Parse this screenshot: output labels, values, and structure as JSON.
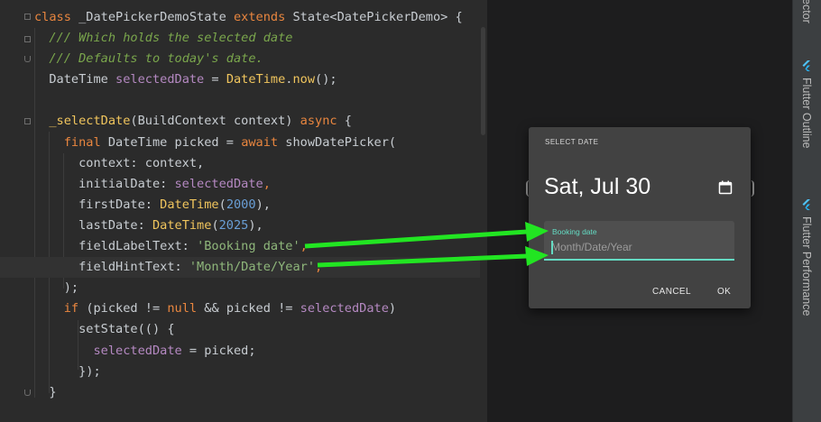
{
  "editor": {
    "lines": [
      [
        [
          "kw",
          "class "
        ],
        [
          "cls",
          "_DatePickerDemoState "
        ],
        [
          "kw",
          "extends "
        ],
        [
          "cls",
          "State<DatePickerDemo> {"
        ]
      ],
      [
        [
          "cls",
          "  "
        ],
        [
          "cm",
          "/// Which holds the selected date"
        ]
      ],
      [
        [
          "cls",
          "  "
        ],
        [
          "cm",
          "/// Defaults to today's date."
        ]
      ],
      [
        [
          "cls",
          "  DateTime "
        ],
        [
          "fld",
          "selectedDate"
        ],
        [
          "cls",
          " = "
        ],
        [
          "fn",
          "DateTime"
        ],
        [
          "cls",
          "."
        ],
        [
          "fn",
          "now"
        ],
        [
          "cls",
          "();"
        ]
      ],
      [
        [
          "cls",
          ""
        ]
      ],
      [
        [
          "cls",
          "  "
        ],
        [
          "fn",
          "_selectDate"
        ],
        [
          "cls",
          "(BuildContext context) "
        ],
        [
          "kw",
          "async "
        ],
        [
          "cls",
          "{"
        ]
      ],
      [
        [
          "cls",
          "    "
        ],
        [
          "kw",
          "final "
        ],
        [
          "cls",
          "DateTime picked = "
        ],
        [
          "kw",
          "await "
        ],
        [
          "cls",
          "showDatePicker("
        ]
      ],
      [
        [
          "cls",
          "      context: context,"
        ]
      ],
      [
        [
          "cls",
          "      initialDate: "
        ],
        [
          "fld",
          "selectedDate"
        ],
        [
          "kw",
          ","
        ]
      ],
      [
        [
          "cls",
          "      firstDate: "
        ],
        [
          "fn",
          "DateTime"
        ],
        [
          "cls",
          "("
        ],
        [
          "num",
          "2000"
        ],
        [
          "cls",
          "),"
        ]
      ],
      [
        [
          "cls",
          "      lastDate: "
        ],
        [
          "fn",
          "DateTime"
        ],
        [
          "cls",
          "("
        ],
        [
          "num",
          "2025"
        ],
        [
          "cls",
          "),"
        ]
      ],
      [
        [
          "cls",
          "      fieldLabelText: "
        ],
        [
          "str",
          "'Booking date'"
        ],
        [
          "kw",
          ","
        ]
      ],
      [
        [
          "cls",
          "      fieldHintText: "
        ],
        [
          "str",
          "'Month/Date/Year'"
        ],
        [
          "kw",
          ","
        ]
      ],
      [
        [
          "cls",
          "    );"
        ]
      ],
      [
        [
          "cls",
          "    "
        ],
        [
          "kw",
          "if "
        ],
        [
          "cls",
          "(picked != "
        ],
        [
          "kw",
          "null "
        ],
        [
          "cls",
          "&& picked != "
        ],
        [
          "fld",
          "selectedDate"
        ],
        [
          "cls",
          ")"
        ]
      ],
      [
        [
          "cls",
          "      setState(() {"
        ]
      ],
      [
        [
          "cls",
          "        "
        ],
        [
          "fld",
          "selectedDate"
        ],
        [
          "cls",
          " = picked;"
        ]
      ],
      [
        [
          "cls",
          "      });"
        ]
      ],
      [
        [
          "cls",
          "  }"
        ]
      ]
    ]
  },
  "dialog": {
    "title": "SELECT DATE",
    "date": "Sat, Jul 30",
    "field_label": "Booking date",
    "field_hint": "Month/Date/Year",
    "cancel_label": "CANCEL",
    "ok_label": "OK",
    "accent_color": "#64dbc3"
  },
  "side_panel": {
    "tabs": [
      {
        "label": "ector",
        "icon": "none"
      },
      {
        "label": "Flutter Outline",
        "icon": "flutter-icon"
      },
      {
        "label": "Flutter Performance",
        "icon": "flutter-icon"
      }
    ]
  },
  "annotation": {
    "arrow_color": "#22e522"
  }
}
